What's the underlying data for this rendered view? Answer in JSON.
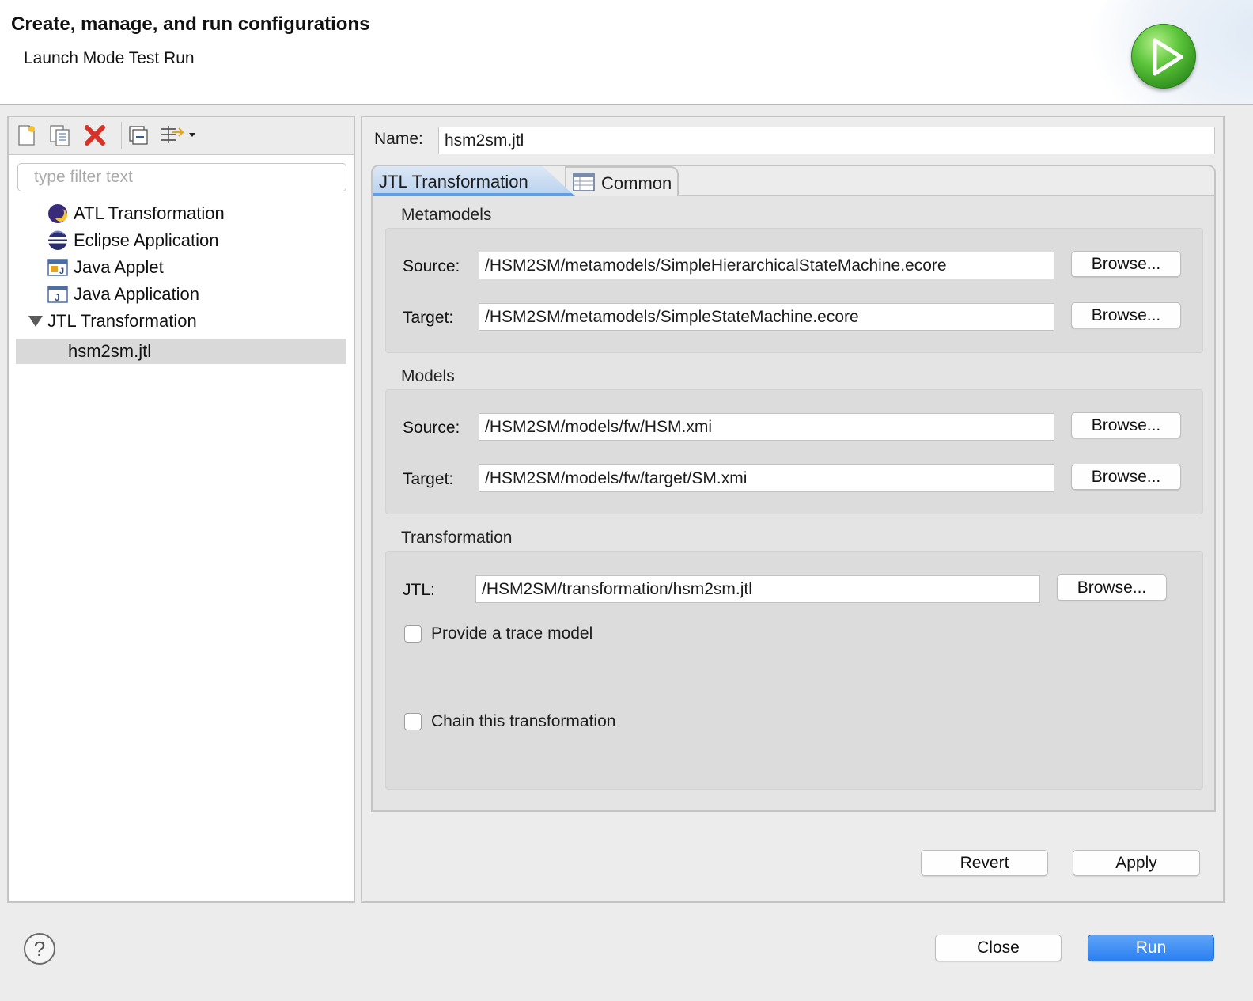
{
  "header": {
    "title": "Create, manage, and run configurations",
    "subtitle": "Launch Mode Test Run"
  },
  "left_panel": {
    "filter_placeholder": "type filter text",
    "tree": [
      {
        "label": "ATL Transformation",
        "icon": "atl-icon"
      },
      {
        "label": "Eclipse Application",
        "icon": "eclipse-icon"
      },
      {
        "label": "Java Applet",
        "icon": "java-applet-icon"
      },
      {
        "label": "Java Application",
        "icon": "java-application-icon"
      },
      {
        "label": "JTL Transformation",
        "icon": "expand-triangle-icon",
        "expanded": true
      },
      {
        "label": "hsm2sm.jtl",
        "selected": true
      }
    ]
  },
  "config": {
    "name_label": "Name:",
    "name_value": "hsm2sm.jtl",
    "tabs": [
      {
        "label": "JTL Transformation",
        "active": true
      },
      {
        "label": "Common",
        "active": false
      }
    ],
    "metamodels": {
      "title": "Metamodels",
      "source_label": "Source:",
      "source_value": "/HSM2SM/metamodels/SimpleHierarchicalStateMachine.ecore",
      "target_label": "Target:",
      "target_value": "/HSM2SM/metamodels/SimpleStateMachine.ecore"
    },
    "models": {
      "title": "Models",
      "source_label": "Source:",
      "source_value": "/HSM2SM/models/fw/HSM.xmi",
      "target_label": "Target:",
      "target_value": "/HSM2SM/models/fw/target/SM.xmi"
    },
    "transformation": {
      "title": "Transformation",
      "jtl_label": "JTL:",
      "jtl_value": "/HSM2SM/transformation/hsm2sm.jtl",
      "trace_label": "Provide a trace model",
      "chain_label": "Chain this transformation"
    },
    "browse_label": "Browse...",
    "revert_label": "Revert",
    "apply_label": "Apply"
  },
  "footer": {
    "help_symbol": "?",
    "close_label": "Close",
    "run_label": "Run"
  },
  "colors": {
    "accent": "#2a7ff2",
    "tab_active": "#bcd3ef",
    "selection": "#d9d9d9"
  }
}
